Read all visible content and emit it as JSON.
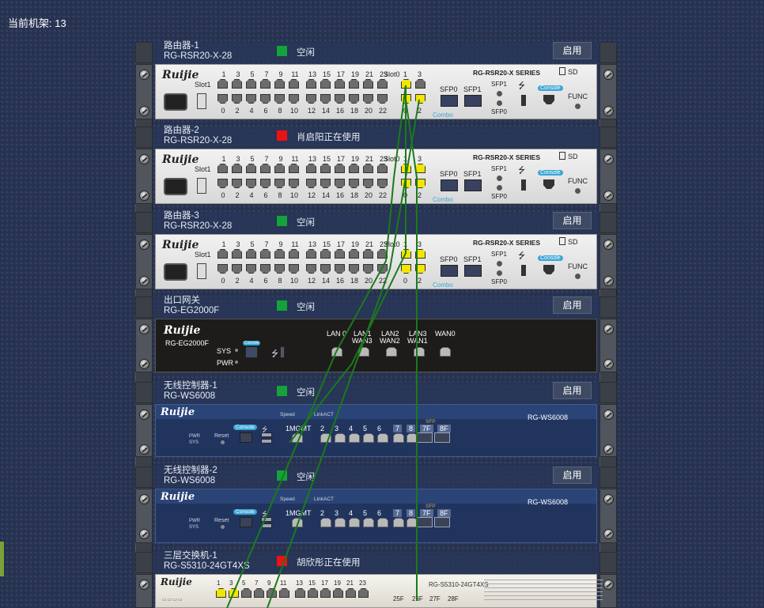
{
  "rack_label": "当前机架: 13",
  "colors": {
    "free": "#13a33a",
    "busy": "#ee1111",
    "cable": "#1a7a1a",
    "port_active": "#f2e600"
  },
  "slots": [
    {
      "name": "路由器-1",
      "model": "RG-RSR20-X-28",
      "status": "free",
      "status_text": "空闲",
      "button": "启用"
    },
    {
      "name": "路由器-2",
      "model": "RG-RSR20-X-28",
      "status": "busy",
      "status_text": "肖启阳正在使用",
      "button": ""
    },
    {
      "name": "路由器-3",
      "model": "RG-RSR20-X-28",
      "status": "free",
      "status_text": "空闲",
      "button": "启用"
    },
    {
      "name": "出口网关",
      "model": "RG-EG2000F",
      "status": "free",
      "status_text": "空闲",
      "button": "启用"
    },
    {
      "name": "无线控制器-1",
      "model": "RG-WS6008",
      "status": "free",
      "status_text": "空闲",
      "button": "启用"
    },
    {
      "name": "无线控制器-2",
      "model": "RG-WS6008",
      "status": "free",
      "status_text": "空闲",
      "button": "启用"
    },
    {
      "name": "三层交换机-1",
      "model": "RG-S5310-24GT4XS",
      "status": "busy",
      "status_text": "胡欣彤正在使用",
      "button": ""
    }
  ],
  "router": {
    "logo": "Ruijie",
    "series": "RG-RSR20-X SERIES",
    "slot1": "Slot1",
    "slot0": "Slot0",
    "top_nums": [
      "1",
      "3",
      "5",
      "7",
      "9",
      "11",
      "13",
      "15",
      "17",
      "19",
      "21",
      "23"
    ],
    "bottom_nums": [
      "0",
      "2",
      "4",
      "6",
      "8",
      "10",
      "12",
      "14",
      "16",
      "18",
      "20",
      "22"
    ],
    "slot0_top": [
      "1",
      "3"
    ],
    "slot0_bottom": [
      "0",
      "2"
    ],
    "sfp0": "SFP0",
    "sfp1": "SFP1",
    "combo": "Combo",
    "sd": "SD",
    "console": "Console",
    "func": "FUNC"
  },
  "gateway": {
    "logo": "Ruijie",
    "model": "RG-EG2000F",
    "sys": "SYS",
    "pwr": "PWR",
    "console": "Console",
    "ports": [
      {
        "top": "LAN 0",
        "bottom": ""
      },
      {
        "top": "LAN1",
        "bottom": "WAN3"
      },
      {
        "top": "LAN2",
        "bottom": "WAN2"
      },
      {
        "top": "LAN3",
        "bottom": "WAN1"
      },
      {
        "top": "WAN0",
        "bottom": ""
      }
    ]
  },
  "wlc": {
    "logo": "Ruijie",
    "model": "RG-WS6008",
    "speed": "Speed",
    "linkact": "LinkACT",
    "console": "Console",
    "reset": "Reset",
    "pwr": "PWR",
    "sys": "SYS",
    "sfp": "SFP",
    "ports": [
      "1MGMT",
      "2",
      "3",
      "4",
      "5",
      "6",
      "7",
      "8",
      "7F",
      "8F"
    ]
  },
  "switch": {
    "logo": "Ruijie",
    "model": "RG-S5310-24GT4XS",
    "top_nums": [
      "1",
      "3",
      "5",
      "7",
      "9",
      "11",
      "13",
      "15",
      "17",
      "19",
      "21",
      "23"
    ],
    "sfp_labels": [
      "25F",
      "26F",
      "27F",
      "28F"
    ]
  }
}
